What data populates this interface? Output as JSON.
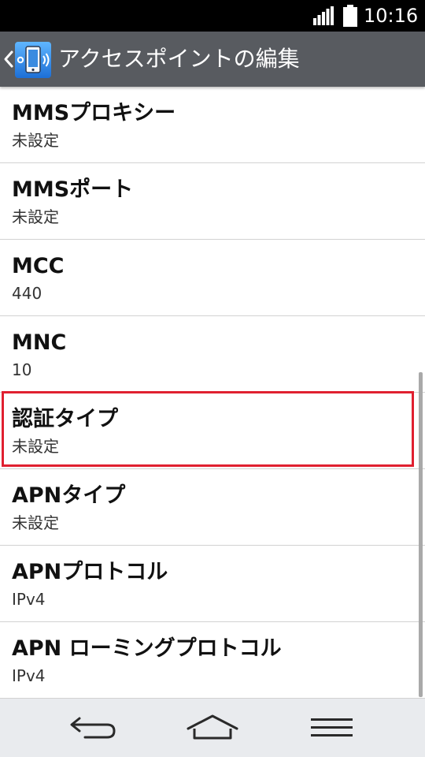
{
  "status_bar": {
    "time": "10:16",
    "signal_icon": "signal-bars-icon",
    "battery_icon": "battery-icon"
  },
  "action_bar": {
    "title": "アクセスポイントの編集",
    "back_icon": "chevron-left-icon",
    "app_icon": "wireless-settings-icon"
  },
  "list": {
    "items": [
      {
        "title": "MMSプロキシー",
        "summary": "未設定"
      },
      {
        "title": "MMSポート",
        "summary": "未設定"
      },
      {
        "title": "MCC",
        "summary": "440"
      },
      {
        "title": "MNC",
        "summary": "10"
      },
      {
        "title": "認証タイプ",
        "summary": "未設定"
      },
      {
        "title": "APNタイプ",
        "summary": "未設定"
      },
      {
        "title": "APNプロトコル",
        "summary": "IPv4"
      },
      {
        "title": "APN ローミングプロトコル",
        "summary": "IPv4"
      }
    ],
    "highlighted_item": 4
  },
  "nav_bar": {
    "back_icon": "back-arrow-icon",
    "home_icon": "home-icon",
    "menu_icon": "menu-icon"
  },
  "colors": {
    "status_bar": "#000000",
    "action_bar": "#585b60",
    "nav_bar": "#e9ebee",
    "highlight": "#e02030",
    "divider": "#d2d2d2"
  }
}
